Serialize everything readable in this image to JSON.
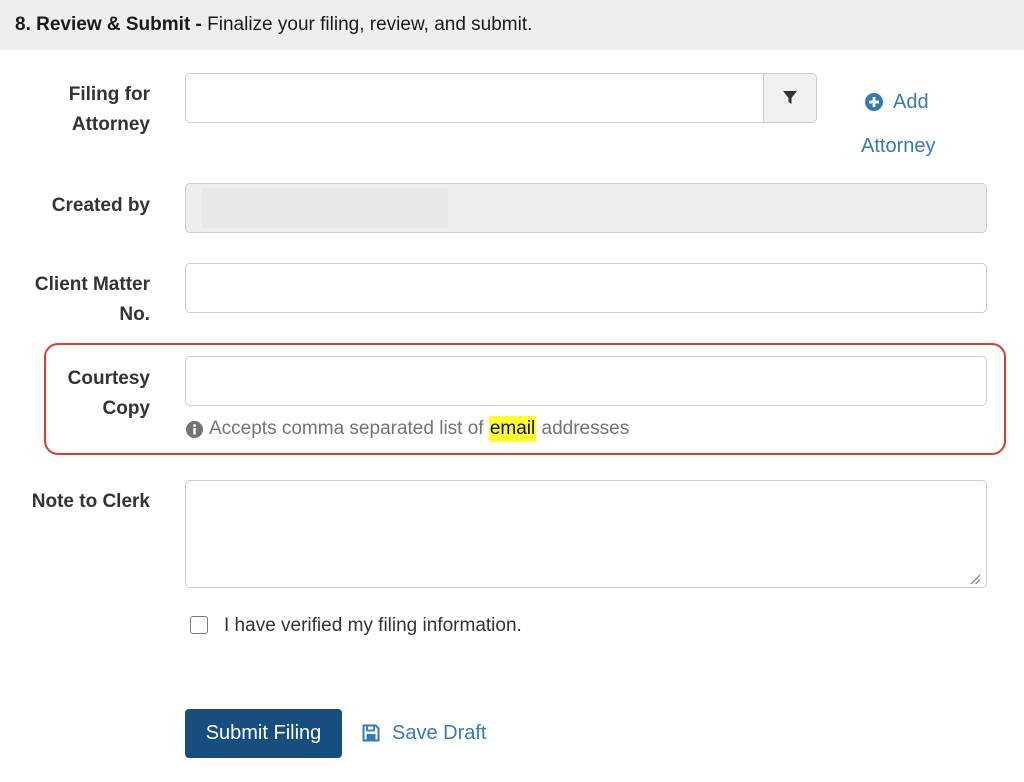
{
  "section": {
    "number_title": "8. Review & Submit -",
    "description": " Finalize your filing, review, and submit."
  },
  "fields": {
    "filing_for": {
      "label_line1": "Filing for",
      "label_line2": "Attorney",
      "value": ""
    },
    "created_by": {
      "label": "Created by",
      "value": ""
    },
    "client_matter": {
      "label_line1": "Client Matter",
      "label_line2": "No.",
      "value": ""
    },
    "courtesy_copy": {
      "label_line1": "Courtesy",
      "label_line2": "Copy",
      "value": "",
      "help_before": "Accepts comma separated list of ",
      "help_highlight": "email",
      "help_after": " addresses"
    },
    "note_to_clerk": {
      "label": "Note to Clerk",
      "value": ""
    }
  },
  "add_attorney": {
    "line1": "Add",
    "line2": "Attorney"
  },
  "verify": {
    "label": "I have verified my filing information.",
    "checked": false
  },
  "actions": {
    "submit_label": "Submit Filing",
    "save_draft_label": "Save Draft"
  },
  "icons": {
    "filter": "filter-icon",
    "add": "plus-circle-icon",
    "info": "info-circle-icon",
    "save": "floppy-disk-icon"
  },
  "colors": {
    "link": "#337ab7",
    "primary_button": "#174e7f",
    "highlight_border": "#e03a2f",
    "search_highlight": "#ffff2e"
  }
}
